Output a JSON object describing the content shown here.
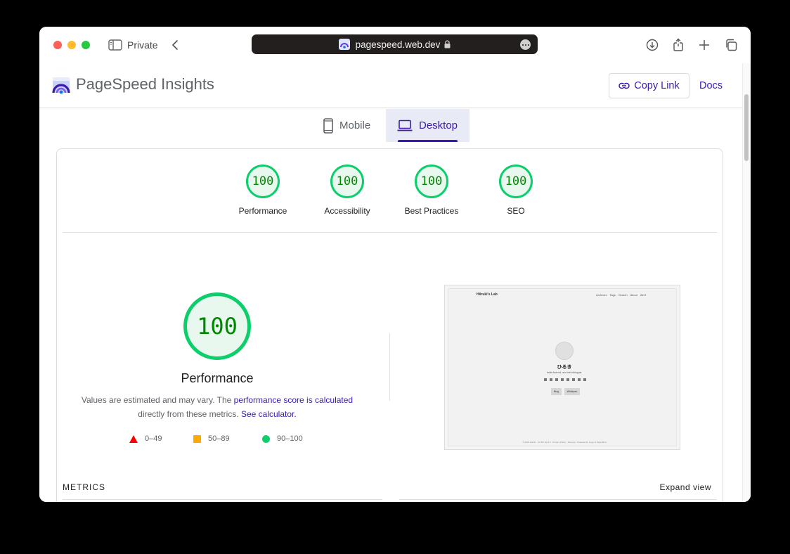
{
  "browser": {
    "private_label": "Private",
    "url": "pagespeed.web.dev"
  },
  "header": {
    "title": "PageSpeed Insights",
    "copy_link_label": "Copy Link",
    "docs_label": "Docs"
  },
  "tabs": [
    {
      "label": "Mobile",
      "selected": false
    },
    {
      "label": "Desktop",
      "selected": true
    }
  ],
  "categories": [
    {
      "score": "100",
      "label": "Performance"
    },
    {
      "score": "100",
      "label": "Accessibility"
    },
    {
      "score": "100",
      "label": "Best Practices"
    },
    {
      "score": "100",
      "label": "SEO"
    }
  ],
  "performance": {
    "score": "100",
    "title": "Performance",
    "desc_prefix": "Values are estimated and may vary. The ",
    "desc_link1": "performance score is calculated",
    "desc_middle": "directly from these metrics. ",
    "desc_link2": "See calculator."
  },
  "legend": [
    {
      "range": "0–49",
      "shape": "triangle",
      "color": "#ff0000"
    },
    {
      "range": "50–89",
      "shape": "square",
      "color": "#ffaa00"
    },
    {
      "range": "90–100",
      "shape": "circle",
      "color": "#0cce6b"
    }
  ],
  "screenshot": {
    "site_title": "Hiiruki's Lab",
    "nav": "Archives Tags Search About Alt.tf",
    "name": "ひるき",
    "bio": "Indie Android, and mini-bilingual.",
    "buttons": [
      "Blog",
      "Whitepan"
    ],
    "footer": "© 2024 Hiiruki · CC BY-SA 4.0 · Privacy Policy · Sitemap · Powered by Hugo & PaperMod"
  },
  "metrics": {
    "label": "METRICS",
    "expand_label": "Expand view"
  },
  "colors": {
    "accent": "#3c1ab0",
    "pass": "#0cce6b",
    "score_text": "#008800"
  }
}
